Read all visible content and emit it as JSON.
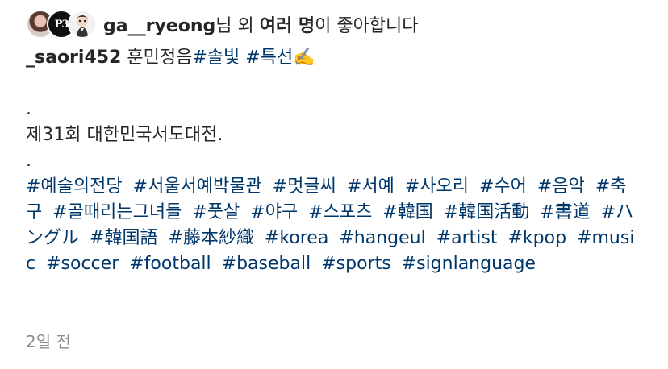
{
  "likes": {
    "user": "ga__ryeong",
    "suffix1": "님 외 ",
    "others_bold": "여러 명",
    "suffix2": "이 좋아합니다"
  },
  "avatars": [
    {
      "name": "user-avatar-1"
    },
    {
      "name": "user-avatar-2",
      "mono": "P3"
    },
    {
      "name": "user-avatar-3"
    }
  ],
  "caption": {
    "username": "_saori452",
    "text1": " 훈민정음",
    "tag1": "#솔빛",
    "space": " ",
    "tag2": "#특선",
    "emoji": "✍️",
    "dot1": ".",
    "line2": "제31회 대한민국서도대전.",
    "dot2": ".",
    "hashtags": [
      "#예술의전당",
      "#서울서예박물관",
      "#멋글씨",
      "#서예",
      "#사오리",
      "#수어",
      "#음악",
      "#축구",
      "#골때리는그녀들",
      "#풋살",
      "#야구",
      "#스포츠",
      "#韓国",
      "#韓国活動",
      "#書道",
      "#ハングル",
      "#韓国語",
      "#藤本紗織",
      "#korea",
      "#hangeul",
      "#artist",
      "#kpop",
      "#music",
      "#soccer",
      "#football",
      "#baseball",
      "#sports",
      "#signlanguage"
    ]
  },
  "timestamp": "2일 전"
}
